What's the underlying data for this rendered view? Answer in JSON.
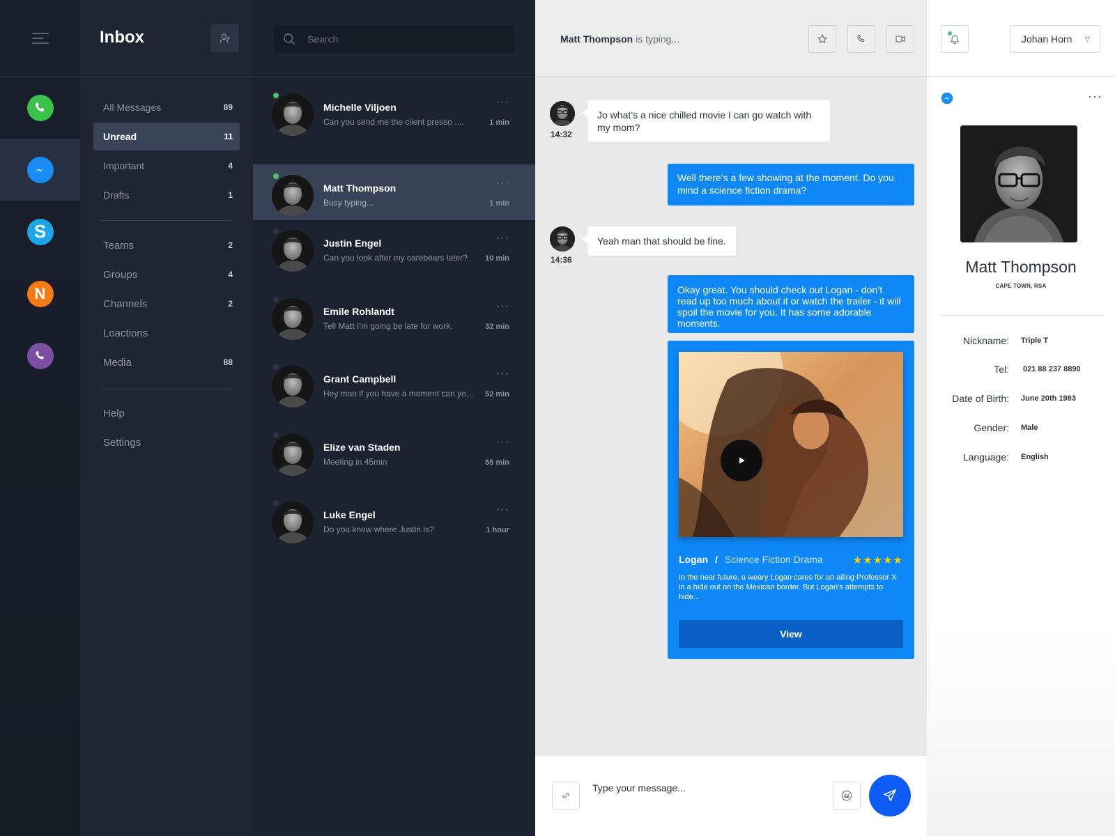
{
  "colors": {
    "accent": "#0e87f7",
    "online": "#4cc469",
    "send": "#0d5cf6",
    "star": "#ffd400"
  },
  "rail": {
    "menu_icon": "hamburger-icon",
    "apps": [
      {
        "name": "WhatsApp",
        "icon": "whatsapp-icon",
        "color": "#3cc24c"
      },
      {
        "name": "Messenger",
        "icon": "messenger-icon",
        "color": "#1a8cf5"
      },
      {
        "name": "Skype",
        "icon": "skype-icon",
        "color": "#1aa7e8"
      },
      {
        "name": "N",
        "icon": "n-app-icon",
        "color": "#f47b16"
      },
      {
        "name": "Viber",
        "icon": "viber-icon",
        "color": "#7b4fa3"
      }
    ]
  },
  "folders": {
    "title": "Inbox",
    "add_icon": "add-contact-icon",
    "primary": [
      {
        "label": "All Messages",
        "count": "89"
      },
      {
        "label": "Unread",
        "count": "11"
      },
      {
        "label": "Important",
        "count": "4"
      },
      {
        "label": "Drafts",
        "count": "1"
      }
    ],
    "secondary": [
      {
        "label": "Teams",
        "count": "2"
      },
      {
        "label": "Groups",
        "count": "4"
      },
      {
        "label": "Channels",
        "count": "2"
      },
      {
        "label": "Loactions",
        "count": ""
      },
      {
        "label": "Media",
        "count": "88"
      }
    ],
    "footer": [
      {
        "label": "Help"
      },
      {
        "label": "Settings"
      }
    ]
  },
  "search": {
    "placeholder": "Search"
  },
  "conversations": [
    {
      "name": "Michelle Viljoen",
      "preview": "Can you send me the client presso ....",
      "time": "1 min",
      "online": true
    },
    {
      "name": "Matt Thompson",
      "preview": "Busy typing...",
      "time": "1 min",
      "online": true
    },
    {
      "name": "Justin Engel",
      "preview": "Can you look after my carebears later?",
      "time": "10 min",
      "online": false
    },
    {
      "name": "Emile Rohlandt",
      "preview": "Tell Matt I’m going be late for work.",
      "time": "32 min",
      "online": false
    },
    {
      "name": "Grant Campbell",
      "preview": "Hey man if you have a moment can you ...",
      "time": "52 min",
      "online": false
    },
    {
      "name": "Elize van Staden",
      "preview": "Meeting in 45min",
      "time": "55 min",
      "online": false
    },
    {
      "name": "Luke Engel",
      "preview": "Do you know where Justin is?",
      "time": "1 hour",
      "online": false
    }
  ],
  "chat": {
    "typing_name": "Matt Thompson",
    "typing_text": "is typing...",
    "messages": [
      {
        "from": "them",
        "text": "Jo what’s a nice chilled movie I can go watch with my mom?",
        "time": "14:32"
      },
      {
        "from": "me",
        "text": "Well there’s a few showing at the moment. Do you mind a science fiction drama?"
      },
      {
        "from": "them",
        "text": "Yeah man that should be fine.",
        "time": "14:36"
      },
      {
        "from": "me",
        "text": "Okay great. You should check out Logan - don’t read up too much about it or watch the trailer - it will spoil the movie for you. It has some adorable moments."
      }
    ],
    "movie": {
      "title": "Logan",
      "genre": "Science Fiction Drama",
      "rating": 5,
      "stars": "★★★★★",
      "description": "In the near future, a weary Logan cares for an ailing Professor X in a hide out on the Mexican border. But Logan's attempts to hide...",
      "button": "View"
    },
    "composer_placeholder": "Type your message..."
  },
  "profile": {
    "user": "Johan Horn",
    "name": "Matt Thompson",
    "location": "CAPE TOWN, RSA",
    "details": [
      {
        "label": "Nickname:",
        "value": "Triple T"
      },
      {
        "label": "Tel:",
        "value": "021 88 237 8890"
      },
      {
        "label": "Date of Birth:",
        "value": "June 20th 1983"
      },
      {
        "label": "Gender:",
        "value": "Male"
      },
      {
        "label": "Language:",
        "value": "English"
      }
    ]
  }
}
